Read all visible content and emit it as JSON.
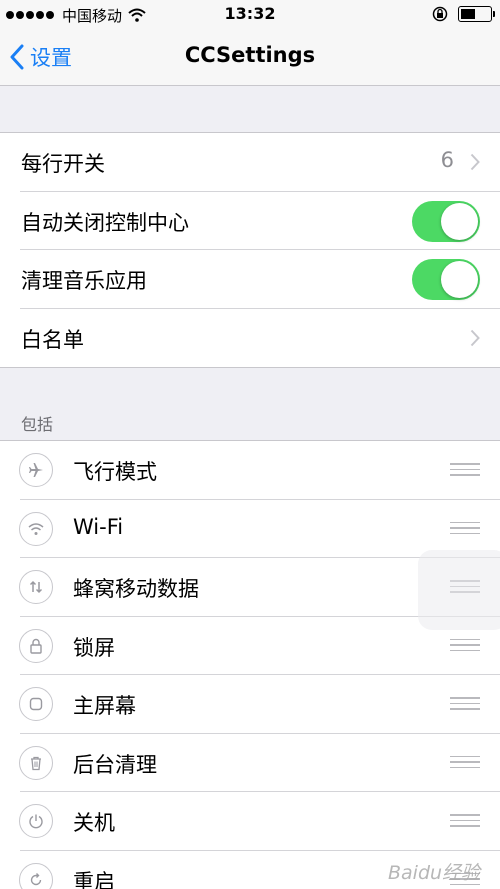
{
  "status_bar": {
    "signal_bars_filled": 5,
    "carrier": "中国移动",
    "time": "13:32",
    "battery_level": 0.5,
    "icons": [
      "wifi-icon",
      "rotation-lock-icon",
      "battery-icon"
    ]
  },
  "nav": {
    "back_label": "设置",
    "title": "CCSettings"
  },
  "settings": [
    {
      "label": "每行开关",
      "value": "6",
      "control": "chevron"
    },
    {
      "label": "自动关闭控制中心",
      "control": "toggle",
      "on": true
    },
    {
      "label": "清理音乐应用",
      "control": "toggle",
      "on": true
    },
    {
      "label": "白名单",
      "control": "chevron"
    }
  ],
  "include_section": {
    "header": "包括",
    "items": [
      {
        "label": "飞行模式",
        "icon": "airplane-icon"
      },
      {
        "label": "Wi-Fi",
        "icon": "wifi-icon"
      },
      {
        "label": "蜂窝移动数据",
        "icon": "cellular-data-icon"
      },
      {
        "label": "锁屏",
        "icon": "lock-icon"
      },
      {
        "label": "主屏幕",
        "icon": "home-screen-icon"
      },
      {
        "label": "后台清理",
        "icon": "trash-icon"
      },
      {
        "label": "关机",
        "icon": "power-icon"
      },
      {
        "label": "重启",
        "icon": "restart-icon"
      }
    ]
  },
  "colors": {
    "accent": "#1a7ff5",
    "toggle_on": "#4cd964",
    "background": "#efeff4"
  },
  "watermark": "Baidu经验"
}
